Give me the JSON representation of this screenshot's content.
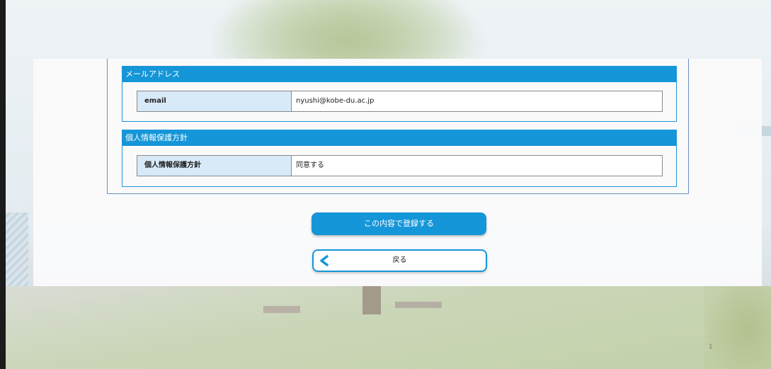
{
  "sections": [
    {
      "header": "メールアドレス",
      "fields": [
        {
          "label": "email",
          "value": "nyushi@kobe-du.ac.jp"
        }
      ]
    },
    {
      "header": "個人情報保護方針",
      "fields": [
        {
          "label": "個人情報保護方針",
          "value": "同意する"
        }
      ]
    }
  ],
  "buttons": {
    "submit_label": "この内容で登録する",
    "back_label": "戻る"
  },
  "background": {
    "page_marker": "1"
  },
  "colors": {
    "accent": "#1596d8",
    "label_bg": "#d8e9f8",
    "panel_bg": "#fafafa"
  }
}
